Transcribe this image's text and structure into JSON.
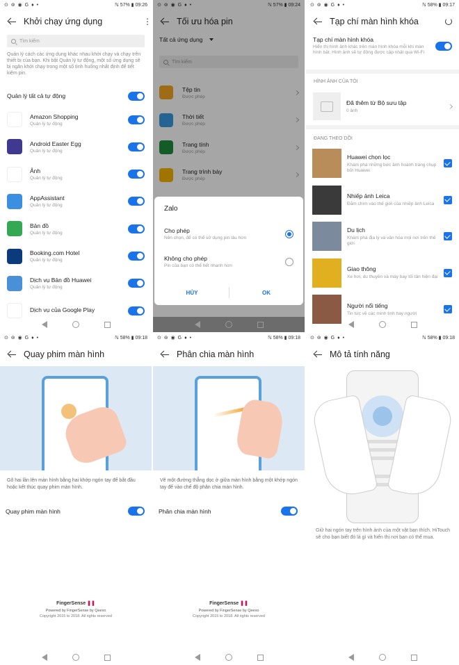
{
  "p1": {
    "status_left": "⊙ ⊚ ◉ G ♦ •",
    "status_right": "ℕ 57% ▮ 09:26",
    "title": "Khởi chạy ứng dụng",
    "search_placeholder": "Tìm kiếm",
    "desc": "Quản lý cách các ứng dụng khác nhau khởi chạy và chạy trên thiết bị của bạn. Khi bật Quản lý tự động, một số ứng dụng sẽ bị ngăn khởi chạy trong một số tình huống nhất định để tiết kiệm pin.",
    "manage_all": "Quản lý tất cả tự động",
    "apps": [
      {
        "name": "Amazon Shopping",
        "sub": "Quản lý tự động",
        "icon": "amazon-icon",
        "color": "#ffffff"
      },
      {
        "name": "Android Easter Egg",
        "sub": "Quản lý tự động",
        "icon": "easter-egg-icon",
        "color": "#3f3a8f"
      },
      {
        "name": "Ảnh",
        "sub": "Quản lý tự động",
        "icon": "photos-icon",
        "color": "#ffffff"
      },
      {
        "name": "AppAssistant",
        "sub": "Quản lý tự động",
        "icon": "app-assistant-icon",
        "color": "#3a8fe0"
      },
      {
        "name": "Bản đồ",
        "sub": "Quản lý tự động",
        "icon": "maps-icon",
        "color": "#34a853"
      },
      {
        "name": "Booking.com Hotel",
        "sub": "Quản lý tự động",
        "icon": "booking-icon",
        "color": "#0c3b7c"
      },
      {
        "name": "Dịch vụ Bản đồ Huawei",
        "sub": "Quản lý tự động",
        "icon": "huawei-maps-icon",
        "color": "#4a90d9"
      },
      {
        "name": "Dịch vụ của Google Play",
        "sub": "",
        "icon": "play-services-icon",
        "color": "#ffffff"
      }
    ]
  },
  "p2": {
    "status_left": "⊙ ⊚ ◉ G ♦ •",
    "status_right": "ℕ 57% ▮ 09:24",
    "title": "Tối ưu hóa pin",
    "filter": "Tất cả ứng dụng",
    "search_placeholder": "Tìm kiếm",
    "apps": [
      {
        "name": "Tệp tin",
        "sub": "Được phép",
        "icon": "files-icon",
        "color": "#f5a623"
      },
      {
        "name": "Thời tiết",
        "sub": "Được phép",
        "icon": "weather-icon",
        "color": "#3a9ae0"
      },
      {
        "name": "Trang tính",
        "sub": "Được phép",
        "icon": "sheets-icon",
        "color": "#1e8e3e"
      },
      {
        "name": "Trang trình bày",
        "sub": "Được phép",
        "icon": "slides-icon",
        "color": "#f4b400"
      }
    ],
    "dialog": {
      "title": "Zalo",
      "opt1": "Cho phép",
      "opt1_sub": "Nên chọn, để có thể sử dụng pin lâu hơn",
      "opt2": "Không cho phép",
      "opt2_sub": "Pin của bạn có thể hết nhanh hơn",
      "cancel": "HỦY",
      "ok": "OK"
    }
  },
  "p3": {
    "status_left": "⊙ ⊚ ◉ G ♦ •",
    "status_right": "ℕ 58% ▮ 09:17",
    "title": "Tạp chí màn hình khóa",
    "toggle_title": "Tạp chí màn hình khóa",
    "toggle_sub": "Hiển thị hình ảnh khác trên màn hình khóa mỗi khi màn hình bật. Hình ảnh sẽ tự động được cập nhật qua Wi-Fi",
    "my_images_header": "HÌNH ẢNH CỦA TÔI",
    "gallery_title": "Đã thêm từ Bộ sưu tập",
    "gallery_count": "0 ảnh",
    "following_header": "ĐANG THEO DÕI",
    "items": [
      {
        "name": "Huawei chọn lọc",
        "sub": "Khám phá những bức ảnh hoành tráng chụp bởi Huawei",
        "color": "#b98d5a"
      },
      {
        "name": "Nhiếp ảnh Leica",
        "sub": "Đắm chìm vào thế giới của nhiếp ảnh Leica",
        "color": "#3a3a3a"
      },
      {
        "name": "Du lịch",
        "sub": "Khám phá địa lý và văn hóa mọi nơi trên thế giới",
        "color": "#7b8a9c"
      },
      {
        "name": "Giao thông",
        "sub": "Xe hơi, du thuyền và máy bay tối tân hiện đại",
        "color": "#e0b020"
      },
      {
        "name": "Người nổi tiếng",
        "sub": "Tin tức về các minh tinh hay người",
        "color": "#8a5a44"
      }
    ]
  },
  "p4": {
    "status_left": "⊙ ⊚ ◉ G ♦ •",
    "status_right": "ℕ 58% ▮ 09:18",
    "title": "Quay phim màn hình",
    "desc": "Gõ hai lần lên màn hình bằng hai khớp ngón tay để bắt đầu hoặc kết thúc quay phim màn hình.",
    "toggle": "Quay phim màn hình",
    "logo_a": "FingerSense",
    "powered": "Powered by FingerSense by Qeexo",
    "copyright": "Copyright 2015 to 2018. All rights reserved"
  },
  "p5": {
    "status_left": "⊙ ⊚ ◉ G ♦ •",
    "status_right": "ℕ 58% ▮ 09:18",
    "title": "Phân chia màn hình",
    "desc": "Vẽ một đường thẳng dọc ở giữa màn hình bằng một khớp ngón tay để vào chế độ phân chia màn hình.",
    "toggle": "Phân chia màn hình",
    "logo_a": "FingerSense",
    "powered": "Powered by FingerSense by Qeexo",
    "copyright": "Copyright 2015 to 2018. All rights reserved"
  },
  "p6": {
    "status_left": "⊙ ⊚ ◉ G ♦ •",
    "status_right": "ℕ 58% ▮ 09:18",
    "title": "Mô tả tính năng",
    "desc": "Giữ hai ngón tay trên hình ảnh của một vật bạn thích. HiTouch sẽ cho bạn biết đó là gì và hiển thị nơi bạn có thể mua."
  },
  "colors": {
    "accent": "#1a73e8",
    "illus_bg": "#dce9f5"
  }
}
